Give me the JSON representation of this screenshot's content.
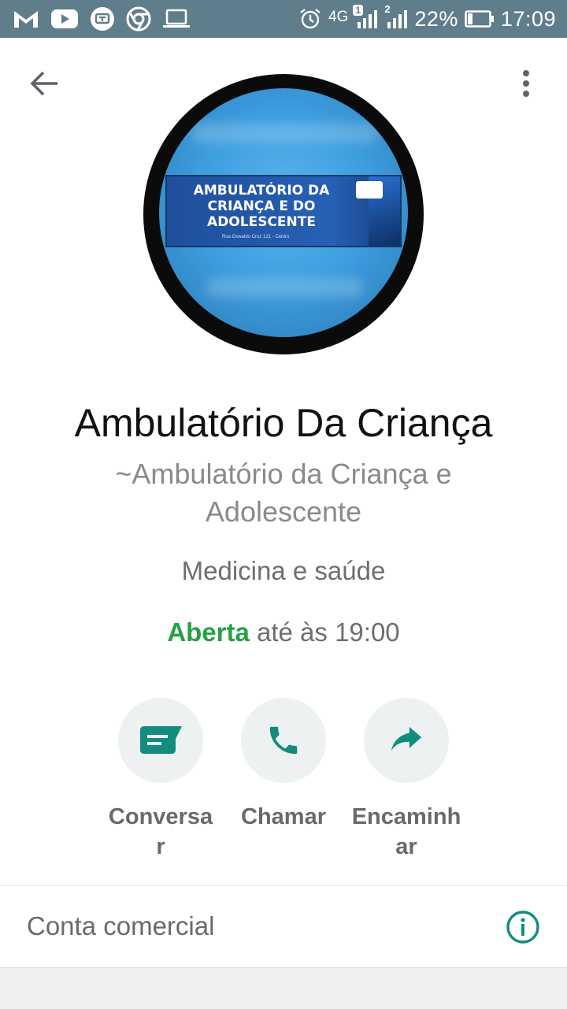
{
  "status_bar": {
    "left_icons": [
      "gmail-icon",
      "youtube-icon",
      "app-icon",
      "chrome-icon",
      "laptop-icon"
    ],
    "network": "4G",
    "sim1": "1",
    "sim2": "2",
    "battery": "22%",
    "time": "17:09"
  },
  "profile": {
    "name": "Ambulatório Da Criança",
    "push_name": "~Ambulatório da Criança e Adolescente",
    "category": "Medicina e saúde",
    "hours_status": "Aberta",
    "hours_text": "até às 19:00",
    "avatar_banner_text": "AMBULATÓRIO DA CRIANÇA E DO ADOLESCENTE",
    "avatar_banner_address": "Rua Oswaldo Cruz 121 - Centro"
  },
  "actions": [
    {
      "label": "Conversar",
      "icon": "message-icon"
    },
    {
      "label": "Chamar",
      "icon": "phone-icon"
    },
    {
      "label": "Encaminhar",
      "icon": "forward-icon"
    }
  ],
  "business": {
    "label": "Conta comercial"
  },
  "colors": {
    "status_bar": "#607d8b",
    "accent": "#128c7e",
    "open": "#25a244"
  }
}
